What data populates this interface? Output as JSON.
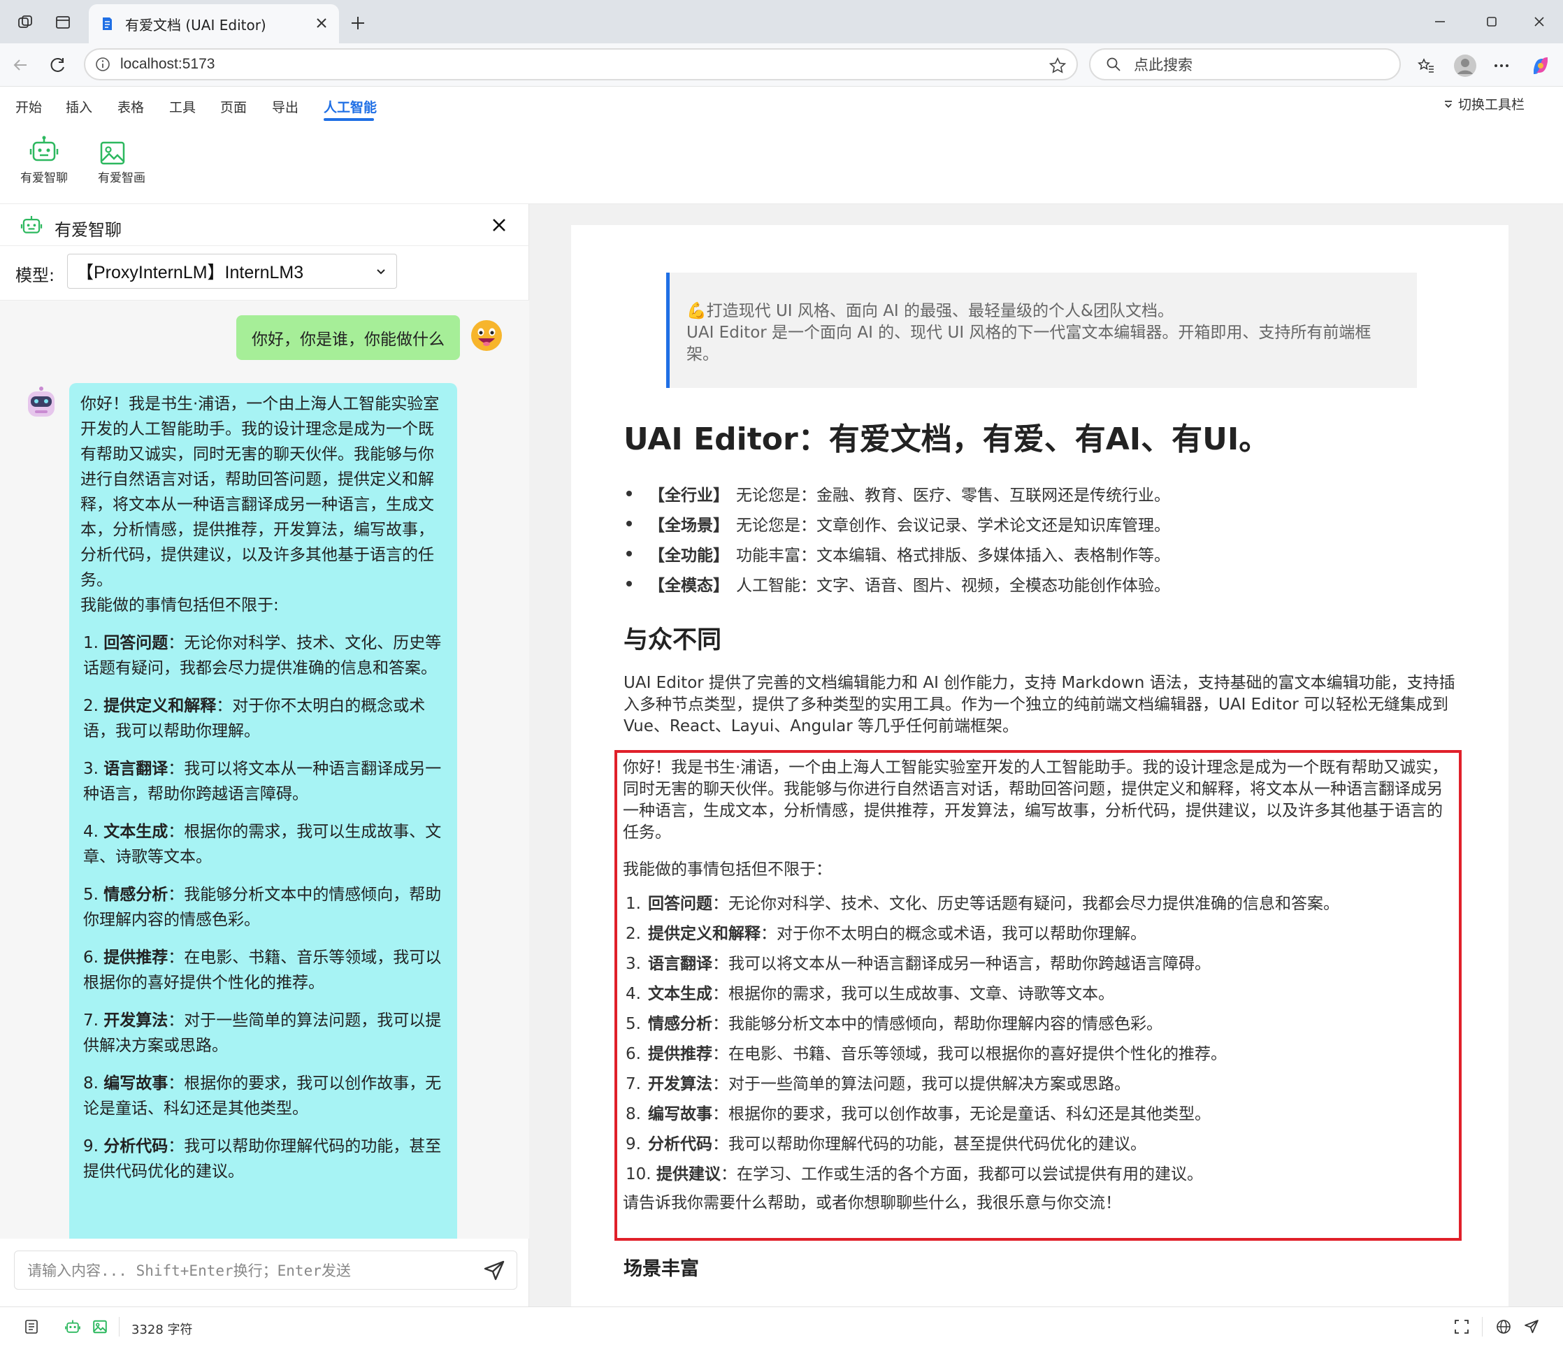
{
  "browser": {
    "tab_title": "有爱文档 (UAI Editor)",
    "url": "localhost:5173",
    "search_placeholder": "点此搜索"
  },
  "menu": {
    "items": [
      "开始",
      "插入",
      "表格",
      "工具",
      "页面",
      "导出",
      "人工智能"
    ],
    "active": "人工智能",
    "toggle_toolbar": "切换工具栏"
  },
  "ai_tools": {
    "chat_label": "有爱智聊",
    "draw_label": "有爱智画"
  },
  "chat": {
    "title": "有爱智聊",
    "model_label": "模型:",
    "model_value": "【ProxyInternLM】InternLM3",
    "user_message": "你好，你是谁，你能做什么",
    "bot_intro": "你好！我是书生·浦语，一个由上海人工智能实验室开发的人工智能助手。我的设计理念是成为一个既有帮助又诚实，同时无害的聊天伙伴。我能够与你进行自然语言对话，帮助回答问题，提供定义和解释，将文本从一种语言翻译成另一种语言，生成文本，分析情感，提供推荐，开发算法，编写故事，分析代码，提供建议，以及许多其他基于语言的任务。",
    "bot_lead": "我能做的事情包括但不限于:",
    "bot_items": [
      {
        "num": "1.",
        "title": "回答问题",
        "text": "：无论你对科学、技术、文化、历史等话题有疑问，我都会尽力提供准确的信息和答案。"
      },
      {
        "num": "2.",
        "title": "提供定义和解释",
        "text": "：对于你不太明白的概念或术语，我可以帮助你理解。"
      },
      {
        "num": "3.",
        "title": "语言翻译",
        "text": "：我可以将文本从一种语言翻译成另一种语言，帮助你跨越语言障碍。"
      },
      {
        "num": "4.",
        "title": "文本生成",
        "text": "：根据你的需求，我可以生成故事、文章、诗歌等文本。"
      },
      {
        "num": "5.",
        "title": "情感分析",
        "text": "：我能够分析文本中的情感倾向，帮助你理解内容的情感色彩。"
      },
      {
        "num": "6.",
        "title": "提供推荐",
        "text": "：在电影、书籍、音乐等领域，我可以根据你的喜好提供个性化的推荐。"
      },
      {
        "num": "7.",
        "title": "开发算法",
        "text": "：对于一些简单的算法问题，我可以提供解决方案或思路。"
      },
      {
        "num": "8.",
        "title": "编写故事",
        "text": "：根据你的要求，我可以创作故事，无论是童话、科幻还是其他类型。"
      },
      {
        "num": "9.",
        "title": "分析代码",
        "text": "：我可以帮助你理解代码的功能，甚至提供代码优化的建议。"
      }
    ],
    "input_placeholder": "请输入内容... Shift+Enter换行；Enter发送"
  },
  "document": {
    "quote_line1": "💪打造现代 UI 风格、面向 AI 的最强、最轻量级的个人&团队文档。",
    "quote_line2": "UAI Editor 是一个面向 AI 的、现代 UI 风格的下一代富文本编辑器。开箱即用、支持所有前端框架。",
    "h1": "UAI Editor：有爱文档，有爱、有AI、有UI。",
    "features": [
      {
        "tag": "【全行业】",
        "text": "无论您是：金融、教育、医疗、零售、互联网还是传统行业。"
      },
      {
        "tag": "【全场景】",
        "text": "无论您是：文章创作、会议记录、学术论文还是知识库管理。"
      },
      {
        "tag": "【全功能】",
        "text": "功能丰富：文本编辑、格式排版、多媒体插入、表格制作等。"
      },
      {
        "tag": "【全模态】",
        "text": "人工智能：文字、语音、图片、视频，全模态功能创作体验。"
      }
    ],
    "h2": "与众不同",
    "paragraph": "UAI Editor 提供了完善的文档编辑能力和 AI 创作能力，支持 Markdown 语法，支持基础的富文本编辑功能，支持插入多种节点类型，提供了多种类型的实用工具。作为一个独立的纯前端文档编辑器，UAI Editor 可以轻松无缝集成到 Vue、React、Layui、Angular 等几乎任何前端框架。",
    "inserted_intro": "你好！我是书生·浦语，一个由上海人工智能实验室开发的人工智能助手。我的设计理念是成为一个既有帮助又诚实，同时无害的聊天伙伴。我能够与你进行自然语言对话，帮助回答问题，提供定义和解释，将文本从一种语言翻译成另一种语言，生成文本，分析情感，提供推荐，开发算法，编写故事，分析代码，提供建议，以及许多其他基于语言的任务。",
    "inserted_lead": "我能做的事情包括但不限于：",
    "inserted_items": [
      {
        "num": "1.",
        "title": "回答问题",
        "text": "：无论你对科学、技术、文化、历史等话题有疑问，我都会尽力提供准确的信息和答案。"
      },
      {
        "num": "2.",
        "title": "提供定义和解释",
        "text": "：对于你不太明白的概念或术语，我可以帮助你理解。"
      },
      {
        "num": "3.",
        "title": "语言翻译",
        "text": "：我可以将文本从一种语言翻译成另一种语言，帮助你跨越语言障碍。"
      },
      {
        "num": "4.",
        "title": "文本生成",
        "text": "：根据你的需求，我可以生成故事、文章、诗歌等文本。"
      },
      {
        "num": "5.",
        "title": "情感分析",
        "text": "：我能够分析文本中的情感倾向，帮助你理解内容的情感色彩。"
      },
      {
        "num": "6.",
        "title": "提供推荐",
        "text": "：在电影、书籍、音乐等领域，我可以根据你的喜好提供个性化的推荐。"
      },
      {
        "num": "7.",
        "title": "开发算法",
        "text": "：对于一些简单的算法问题，我可以提供解决方案或思路。"
      },
      {
        "num": "8.",
        "title": "编写故事",
        "text": "：根据你的要求，我可以创作故事，无论是童话、科幻还是其他类型。"
      },
      {
        "num": "9.",
        "title": "分析代码",
        "text": "：我可以帮助你理解代码的功能，甚至提供代码优化的建议。"
      },
      {
        "num": "10.",
        "title": "提供建议",
        "text": "：在学习、工作或生活的各个方面，我都可以尝试提供有用的建议。"
      }
    ],
    "inserted_outro": "请告诉我你需要什么帮助，或者你想聊聊些什么，我很乐意与你交流！",
    "h3": "场景丰富"
  },
  "status": {
    "char_count": "3328 字符"
  },
  "colors": {
    "accent": "#1f6fe5",
    "ai_green": "#2db85f",
    "user_bubble": "#a6ee98",
    "bot_bubble": "#a7f3f4",
    "highlight_border": "#e0202a"
  }
}
